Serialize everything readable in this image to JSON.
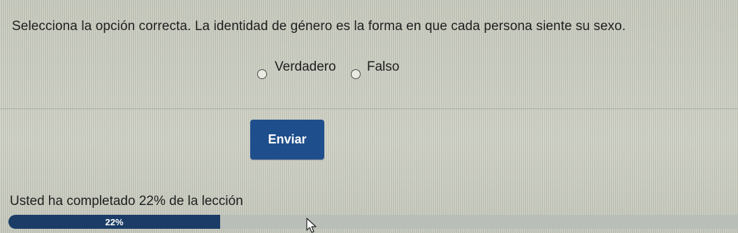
{
  "question": {
    "text": "Selecciona la opción correcta. La identidad de género es la forma en que cada persona siente su sexo."
  },
  "options": [
    {
      "label": "Verdadero",
      "selected": false
    },
    {
      "label": "Falso",
      "selected": false
    }
  ],
  "submit": {
    "label": "Enviar"
  },
  "progress": {
    "text": "Usted ha completado 22% de la lección",
    "label": "22%",
    "fraction": 0.29
  },
  "colors": {
    "button": "#1f4e8c",
    "progress_fill": "#1a3c66",
    "progress_track": "#b9bfb8"
  },
  "icons": {
    "radio": "radio-unchecked-icon",
    "cursor": "mouse-pointer-icon"
  }
}
